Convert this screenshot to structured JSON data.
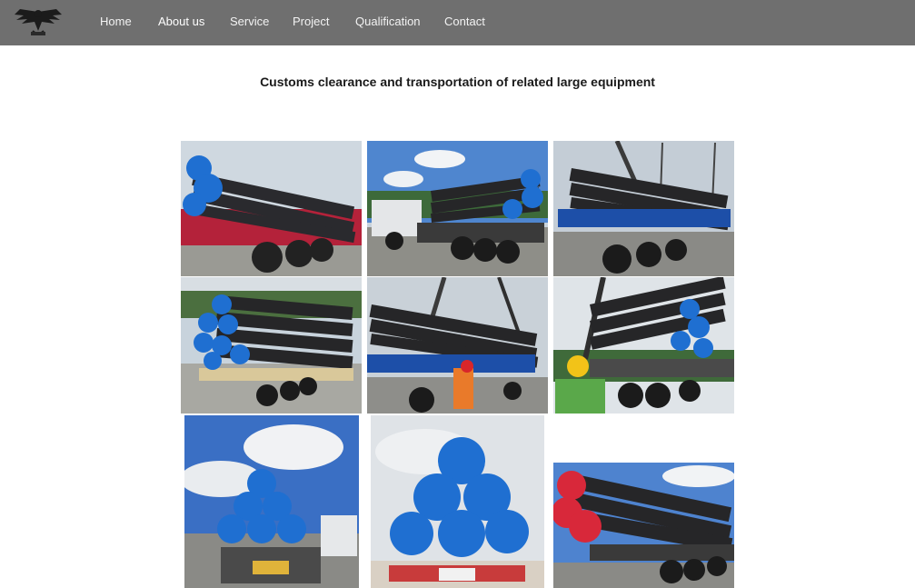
{
  "nav": {
    "logo_icon": "eagle-logo-icon",
    "items": [
      {
        "label": "Home"
      },
      {
        "label": "About us",
        "active": true
      },
      {
        "label": "Service"
      },
      {
        "label": "Project"
      },
      {
        "label": "Qualification"
      },
      {
        "label": "Contact"
      }
    ]
  },
  "main": {
    "heading": "Customs clearance and transportation of related large equipment"
  },
  "colors": {
    "navbar": "#6f6f6f",
    "pipe_cap_blue": "#1f6fd1",
    "pipe_cap_red": "#d8283a",
    "trailer_red": "#b4223a",
    "trailer_blue": "#1d4fa8"
  }
}
